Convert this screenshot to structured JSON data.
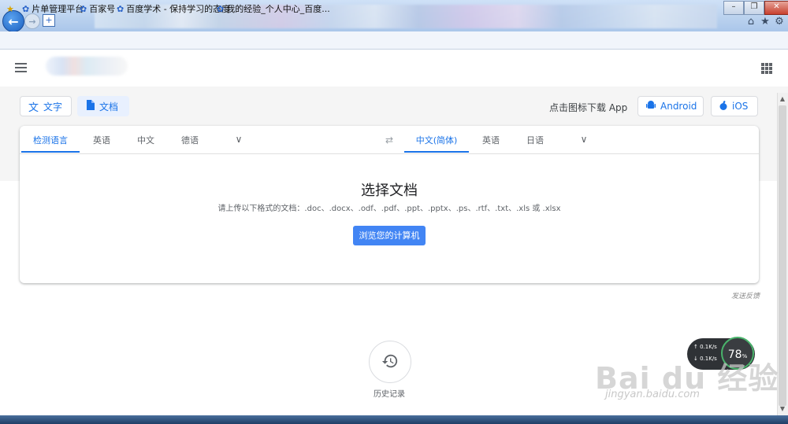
{
  "browser": {
    "favorites": [
      {
        "label": "片单管理平台"
      },
      {
        "label": "百家号"
      },
      {
        "label": "百度学术 - 保持学习的态度"
      },
      {
        "label": "我的经验_个人中心_百度..."
      }
    ]
  },
  "header": {
    "menu_icon": "menu-icon",
    "apps_icon": "apps-grid-icon"
  },
  "mode_tabs": [
    {
      "label": "文字",
      "icon": "translate-icon",
      "selected": false
    },
    {
      "label": "文档",
      "icon": "document-icon",
      "selected": true
    }
  ],
  "download": {
    "label": "点击图标下载 App",
    "android_label": "Android",
    "ios_label": "iOS"
  },
  "source_langs": [
    "检测语言",
    "英语",
    "中文",
    "德语"
  ],
  "target_langs": [
    "中文(简体)",
    "英语",
    "日语"
  ],
  "upload": {
    "title": "选择文档",
    "formats": "请上传以下格式的文档：.doc、.docx、.odf、.pdf、.ppt、.pptx、.ps、.rtf、.txt、.xls 或 .xlsx",
    "browse_label": "浏览您的计算机"
  },
  "feedback_label": "发送反馈",
  "history_label": "历史记录",
  "speed_widget": {
    "up": "0.1K/s",
    "down": "0.1K/s",
    "percent": "78",
    "percent_unit": "%"
  },
  "watermark": {
    "brand": "Bai du 经验",
    "url": "jingyan.baidu.com"
  },
  "colors": {
    "accent": "#1a73e8",
    "button_blue": "#4285f4",
    "selected_tab_bg": "#e8f0fe"
  }
}
